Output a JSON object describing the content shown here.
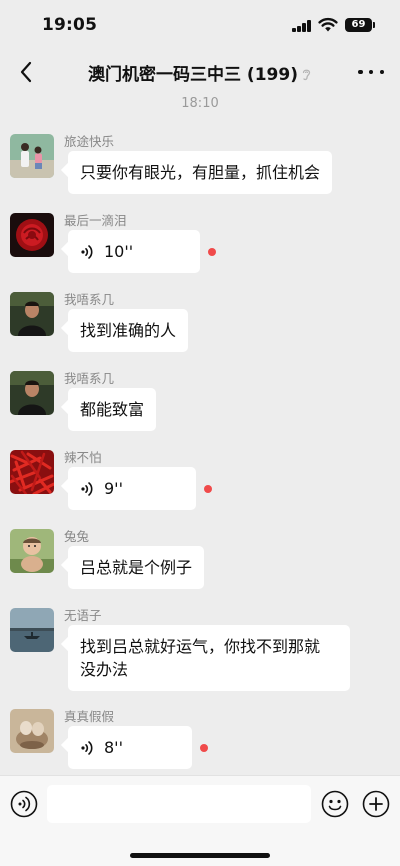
{
  "status_bar": {
    "time": "19:05",
    "battery": "69"
  },
  "nav": {
    "title": "澳门机密一码三中三 (199)"
  },
  "chat": {
    "timestamp": "18:10",
    "messages": [
      {
        "sender": "旅途快乐",
        "type": "text",
        "lines": [
          "只要你有眼光，有胆量，抓住机会"
        ]
      },
      {
        "sender": "最后一滴泪",
        "type": "voice",
        "duration": "10''",
        "unread": true
      },
      {
        "sender": "我唔系几",
        "type": "text",
        "lines": [
          "找到准确的人"
        ]
      },
      {
        "sender": "我唔系几",
        "type": "text",
        "lines": [
          "都能致富"
        ]
      },
      {
        "sender": "辣不怕",
        "type": "voice",
        "duration": "9''",
        "unread": true
      },
      {
        "sender": "兔兔",
        "type": "text",
        "lines": [
          "吕总就是个例子"
        ]
      },
      {
        "sender": "无语子",
        "type": "text",
        "lines": [
          "找到吕总就好运气，你找不到那就",
          "没办法"
        ]
      },
      {
        "sender": "真真假假",
        "type": "voice",
        "duration": "8''",
        "unread": true
      }
    ]
  },
  "input": {
    "value": ""
  },
  "colors": {
    "background": "#ededed",
    "bubble": "#ffffff",
    "unread_dot": "#f04a4a"
  },
  "icons": [
    "back-icon",
    "mute-icon",
    "more-icon",
    "voice-wave-icon",
    "voice-input-icon",
    "emoji-icon",
    "plus-icon"
  ]
}
